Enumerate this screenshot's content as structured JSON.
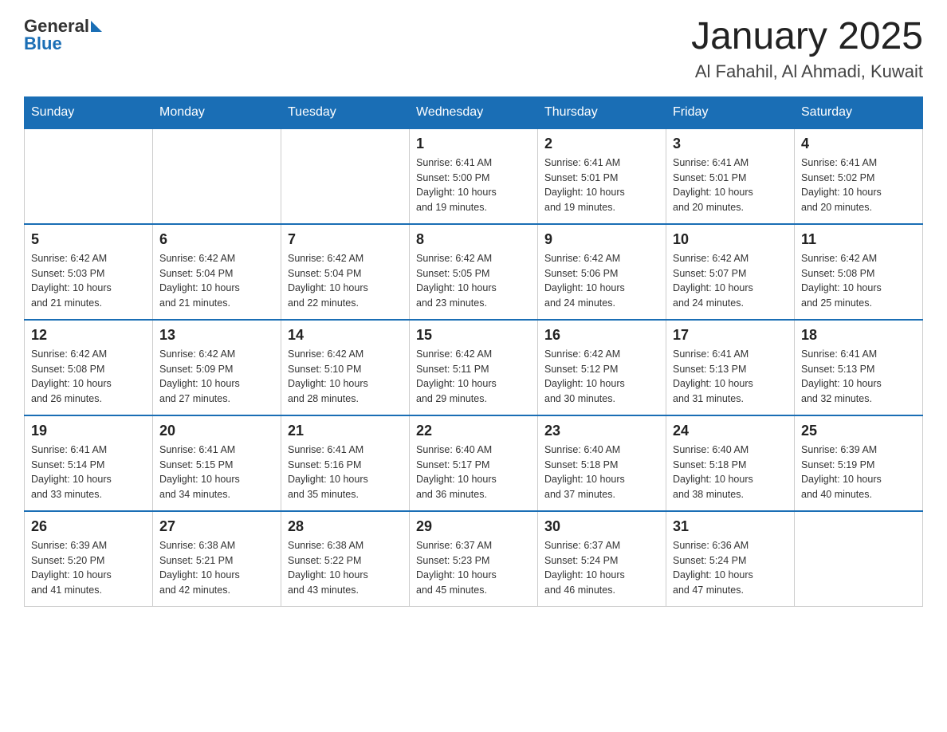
{
  "logo": {
    "text_general": "General",
    "text_blue": "Blue"
  },
  "header": {
    "month_year": "January 2025",
    "location": "Al Fahahil, Al Ahmadi, Kuwait"
  },
  "days_of_week": [
    "Sunday",
    "Monday",
    "Tuesday",
    "Wednesday",
    "Thursday",
    "Friday",
    "Saturday"
  ],
  "weeks": [
    [
      {
        "day": "",
        "info": ""
      },
      {
        "day": "",
        "info": ""
      },
      {
        "day": "",
        "info": ""
      },
      {
        "day": "1",
        "info": "Sunrise: 6:41 AM\nSunset: 5:00 PM\nDaylight: 10 hours\nand 19 minutes."
      },
      {
        "day": "2",
        "info": "Sunrise: 6:41 AM\nSunset: 5:01 PM\nDaylight: 10 hours\nand 19 minutes."
      },
      {
        "day": "3",
        "info": "Sunrise: 6:41 AM\nSunset: 5:01 PM\nDaylight: 10 hours\nand 20 minutes."
      },
      {
        "day": "4",
        "info": "Sunrise: 6:41 AM\nSunset: 5:02 PM\nDaylight: 10 hours\nand 20 minutes."
      }
    ],
    [
      {
        "day": "5",
        "info": "Sunrise: 6:42 AM\nSunset: 5:03 PM\nDaylight: 10 hours\nand 21 minutes."
      },
      {
        "day": "6",
        "info": "Sunrise: 6:42 AM\nSunset: 5:04 PM\nDaylight: 10 hours\nand 21 minutes."
      },
      {
        "day": "7",
        "info": "Sunrise: 6:42 AM\nSunset: 5:04 PM\nDaylight: 10 hours\nand 22 minutes."
      },
      {
        "day": "8",
        "info": "Sunrise: 6:42 AM\nSunset: 5:05 PM\nDaylight: 10 hours\nand 23 minutes."
      },
      {
        "day": "9",
        "info": "Sunrise: 6:42 AM\nSunset: 5:06 PM\nDaylight: 10 hours\nand 24 minutes."
      },
      {
        "day": "10",
        "info": "Sunrise: 6:42 AM\nSunset: 5:07 PM\nDaylight: 10 hours\nand 24 minutes."
      },
      {
        "day": "11",
        "info": "Sunrise: 6:42 AM\nSunset: 5:08 PM\nDaylight: 10 hours\nand 25 minutes."
      }
    ],
    [
      {
        "day": "12",
        "info": "Sunrise: 6:42 AM\nSunset: 5:08 PM\nDaylight: 10 hours\nand 26 minutes."
      },
      {
        "day": "13",
        "info": "Sunrise: 6:42 AM\nSunset: 5:09 PM\nDaylight: 10 hours\nand 27 minutes."
      },
      {
        "day": "14",
        "info": "Sunrise: 6:42 AM\nSunset: 5:10 PM\nDaylight: 10 hours\nand 28 minutes."
      },
      {
        "day": "15",
        "info": "Sunrise: 6:42 AM\nSunset: 5:11 PM\nDaylight: 10 hours\nand 29 minutes."
      },
      {
        "day": "16",
        "info": "Sunrise: 6:42 AM\nSunset: 5:12 PM\nDaylight: 10 hours\nand 30 minutes."
      },
      {
        "day": "17",
        "info": "Sunrise: 6:41 AM\nSunset: 5:13 PM\nDaylight: 10 hours\nand 31 minutes."
      },
      {
        "day": "18",
        "info": "Sunrise: 6:41 AM\nSunset: 5:13 PM\nDaylight: 10 hours\nand 32 minutes."
      }
    ],
    [
      {
        "day": "19",
        "info": "Sunrise: 6:41 AM\nSunset: 5:14 PM\nDaylight: 10 hours\nand 33 minutes."
      },
      {
        "day": "20",
        "info": "Sunrise: 6:41 AM\nSunset: 5:15 PM\nDaylight: 10 hours\nand 34 minutes."
      },
      {
        "day": "21",
        "info": "Sunrise: 6:41 AM\nSunset: 5:16 PM\nDaylight: 10 hours\nand 35 minutes."
      },
      {
        "day": "22",
        "info": "Sunrise: 6:40 AM\nSunset: 5:17 PM\nDaylight: 10 hours\nand 36 minutes."
      },
      {
        "day": "23",
        "info": "Sunrise: 6:40 AM\nSunset: 5:18 PM\nDaylight: 10 hours\nand 37 minutes."
      },
      {
        "day": "24",
        "info": "Sunrise: 6:40 AM\nSunset: 5:18 PM\nDaylight: 10 hours\nand 38 minutes."
      },
      {
        "day": "25",
        "info": "Sunrise: 6:39 AM\nSunset: 5:19 PM\nDaylight: 10 hours\nand 40 minutes."
      }
    ],
    [
      {
        "day": "26",
        "info": "Sunrise: 6:39 AM\nSunset: 5:20 PM\nDaylight: 10 hours\nand 41 minutes."
      },
      {
        "day": "27",
        "info": "Sunrise: 6:38 AM\nSunset: 5:21 PM\nDaylight: 10 hours\nand 42 minutes."
      },
      {
        "day": "28",
        "info": "Sunrise: 6:38 AM\nSunset: 5:22 PM\nDaylight: 10 hours\nand 43 minutes."
      },
      {
        "day": "29",
        "info": "Sunrise: 6:37 AM\nSunset: 5:23 PM\nDaylight: 10 hours\nand 45 minutes."
      },
      {
        "day": "30",
        "info": "Sunrise: 6:37 AM\nSunset: 5:24 PM\nDaylight: 10 hours\nand 46 minutes."
      },
      {
        "day": "31",
        "info": "Sunrise: 6:36 AM\nSunset: 5:24 PM\nDaylight: 10 hours\nand 47 minutes."
      },
      {
        "day": "",
        "info": ""
      }
    ]
  ]
}
